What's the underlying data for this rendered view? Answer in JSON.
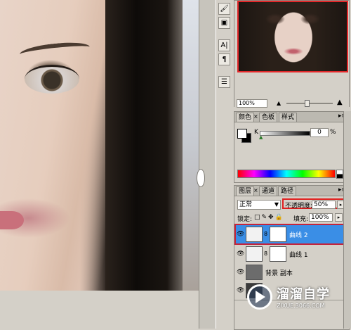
{
  "toolbar": {
    "buttons": [
      {
        "icon": "brush-tool-icon",
        "glyph": "🖌"
      },
      {
        "icon": "stamp-tool-icon",
        "glyph": "▣"
      },
      {
        "icon": "character-panel-icon",
        "glyph": "A|"
      },
      {
        "icon": "paragraph-panel-icon",
        "glyph": "¶"
      },
      {
        "icon": "layer-comps-icon",
        "glyph": "☰"
      }
    ]
  },
  "navigator": {
    "zoom": "100%"
  },
  "color_panel": {
    "tabs": [
      "颜色",
      "色板",
      "样式"
    ],
    "channel_label": "K",
    "channel_value": "0",
    "percent": "%",
    "colors": {
      "foreground": "#ffffff",
      "background": "#000000"
    }
  },
  "layers_panel": {
    "tabs": [
      "图层",
      "通道",
      "路径"
    ],
    "blend_mode": "正常",
    "opacity_label": "不透明度:",
    "opacity_value": "50%",
    "lock_label": "锁定:",
    "fill_label": "填充:",
    "fill_value": "100%",
    "layers": [
      {
        "name": "曲线 2",
        "selected": true
      },
      {
        "name": "曲线 1",
        "selected": false
      },
      {
        "name": "背景 副本",
        "selected": false
      },
      {
        "name": "",
        "selected": false
      }
    ],
    "colors": {
      "selection": "#3a8ee6",
      "highlight_frame": "#c4243c"
    }
  },
  "watermark": {
    "name": "溜溜自学",
    "url": "ZIXUE.3066.COM"
  }
}
